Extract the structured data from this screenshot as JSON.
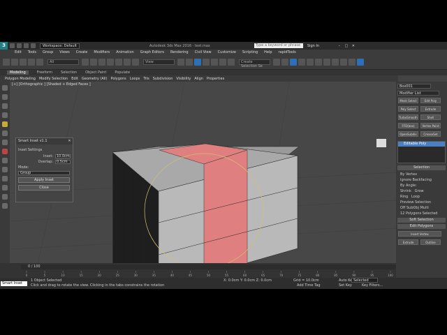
{
  "titlebar": {
    "logo": "3",
    "workspace": "Workspace: Default",
    "app_title": "Autodesk 3ds Max 2016 · test.max",
    "search_placeholder": "Type a keyword or phrase",
    "sign_in": "Sign In"
  },
  "menu": [
    "Edit",
    "Tools",
    "Group",
    "Views",
    "Create",
    "Modifiers",
    "Animation",
    "Graph Editors",
    "Rendering",
    "Civil View",
    "Customize",
    "Scripting",
    "Help",
    "rapidTools"
  ],
  "toolbar": {
    "selection_filter": "All",
    "view": "View",
    "named_selection": "Create Selection Se"
  },
  "ribbon_tabs": [
    "Modeling",
    "Freeform",
    "Selection",
    "Object Paint",
    "Populate"
  ],
  "ribbon_items": [
    "Polygon Modeling",
    "Modify Selection",
    "Edit",
    "Geometry (All)",
    "Polygons",
    "Loops",
    "Tris",
    "Subdivision",
    "Visibility",
    "Align",
    "Properties"
  ],
  "viewport": {
    "label": "[+] [Orthographic ] [Shaded + Edged Faces ]"
  },
  "dialog": {
    "title": "Smart Inset v1.1",
    "group_settings": "Inset Settings",
    "inset_label": "Inset:",
    "inset_value": "10.0cm",
    "overlap_label": "Overlap:",
    "overlap_value": "0.5cm",
    "mode_label": "Mode:",
    "mode_value": "Group",
    "apply_button": "Apply Inset",
    "close_button": "Close"
  },
  "command_panel": {
    "object_name": "Box001",
    "modifier_list": "Modifier List",
    "buttons": [
      "Mesh Select",
      "Edit Poly",
      "Poly Select",
      "Extrude",
      "TurboSmooth",
      "Shell",
      "FFD(box)",
      "Vertex Paint",
      "OpenSubdiv",
      "CreaseSet"
    ],
    "stack_item": "Editable Poly",
    "selection_header": "Selection",
    "by_vertex": "By Vertex",
    "ignore_backfacing": "Ignore Backfacing",
    "by_angle": "By Angle:",
    "shrink": "Shrink",
    "grow": "Grow",
    "ring": "Ring",
    "loop": "Loop",
    "preview_selection": "Preview Selection",
    "off": "Off",
    "subobj": "SubObj",
    "multi": "Multi",
    "selected_count": "12 Polygons Selected",
    "soft_selection": "Soft Selection",
    "edit_polygons": "Edit Polygons",
    "insert_vertex": "Insert Vertex",
    "extrude": "Extrude",
    "outline": "Outline"
  },
  "timeline": {
    "frame": "0 / 100",
    "ticks": [
      "0",
      "5",
      "10",
      "15",
      "20",
      "25",
      "30",
      "35",
      "40",
      "45",
      "50",
      "55",
      "60",
      "65",
      "70",
      "75",
      "80",
      "85",
      "90",
      "95",
      "100"
    ]
  },
  "status": {
    "maxscript": "Smart Inset",
    "line1": "1 Object Selected",
    "line2": "Click and drag to rotate the view.  Clicking in the tabs constrains the rotation",
    "coords": "X: 0.0cm   Y: 0.0cm   Z: 0.0cm",
    "grid": "Grid = 10.0cm",
    "add_time_tag": "Add Time Tag",
    "auto_key": "Auto Key",
    "selected": "Selected",
    "set_key": "Set Key",
    "key_filters": "Key Filters..."
  },
  "colors": {
    "accent": "#4a7fc1",
    "selected_face": "#e07f7f"
  }
}
